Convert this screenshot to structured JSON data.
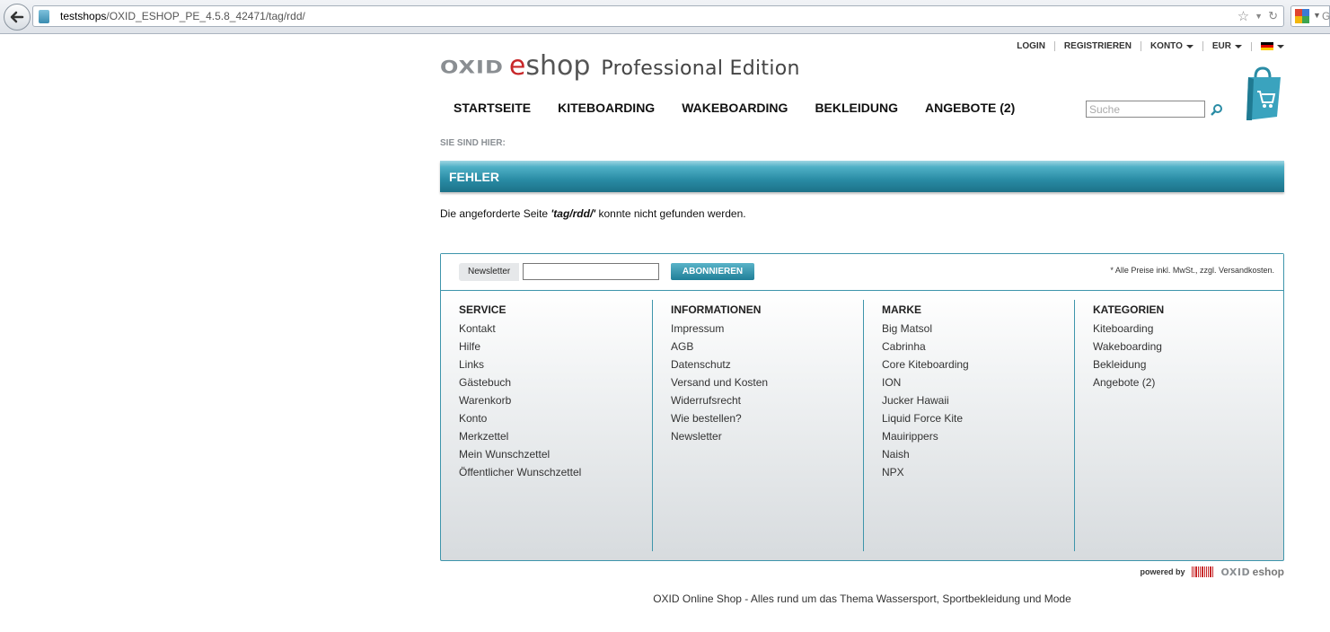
{
  "browser": {
    "url_host": "testshops",
    "url_path": "/OXID_ESHOP_PE_4.5.8_42471/tag/rdd/",
    "ext_letter": "G"
  },
  "logo": {
    "oxid": "OXID",
    "e": "e",
    "shop": "shop",
    "edition": "Professional Edition"
  },
  "topmenu": {
    "login": "LOGIN",
    "register": "REGISTRIEREN",
    "account": "KONTO",
    "currency": "EUR"
  },
  "nav": [
    "STARTSEITE",
    "KITEBOARDING",
    "WAKEBOARDING",
    "BEKLEIDUNG",
    "ANGEBOTE (2)"
  ],
  "search": {
    "placeholder": "Suche"
  },
  "breadcrumb": "SIE SIND HIER:",
  "error": {
    "title": "FEHLER",
    "msg_before": "Die angeforderte Seite ",
    "msg_path": "'tag/rdd/'",
    "msg_after": " konnte nicht gefunden werden."
  },
  "newsletter": {
    "label": "Newsletter",
    "button": "ABONNIEREN",
    "note": "* Alle Preise inkl. MwSt., zzgl. Versandkosten."
  },
  "footer": {
    "service": {
      "title": "SERVICE",
      "links": [
        "Kontakt",
        "Hilfe",
        "Links",
        "Gästebuch",
        "Warenkorb",
        "Konto",
        "Merkzettel",
        "Mein Wunschzettel",
        "Öffentlicher Wunschzettel"
      ]
    },
    "info": {
      "title": "INFORMATIONEN",
      "links": [
        "Impressum",
        "AGB",
        "Datenschutz",
        "Versand und Kosten",
        "Widerrufsrecht",
        "Wie bestellen?",
        "Newsletter"
      ]
    },
    "brands": {
      "title": "MARKE",
      "links": [
        "Big Matsol",
        "Cabrinha",
        "Core Kiteboarding",
        "ION",
        "Jucker Hawaii",
        "Liquid Force Kite",
        "Mauirippers",
        "Naish",
        "NPX"
      ]
    },
    "categories": {
      "title": "KATEGORIEN",
      "links": [
        "Kiteboarding",
        "Wakeboarding",
        "Bekleidung",
        "Angebote (2)"
      ]
    }
  },
  "powered": {
    "label": "powered by",
    "oxid": "OXID",
    "eshop": "eshop"
  },
  "tagline": "OXID Online Shop - Alles rund um das Thema Wassersport, Sportbekleidung und Mode",
  "colors": {
    "accent": "#2a8ca5",
    "logo_red": "#c8282a"
  }
}
